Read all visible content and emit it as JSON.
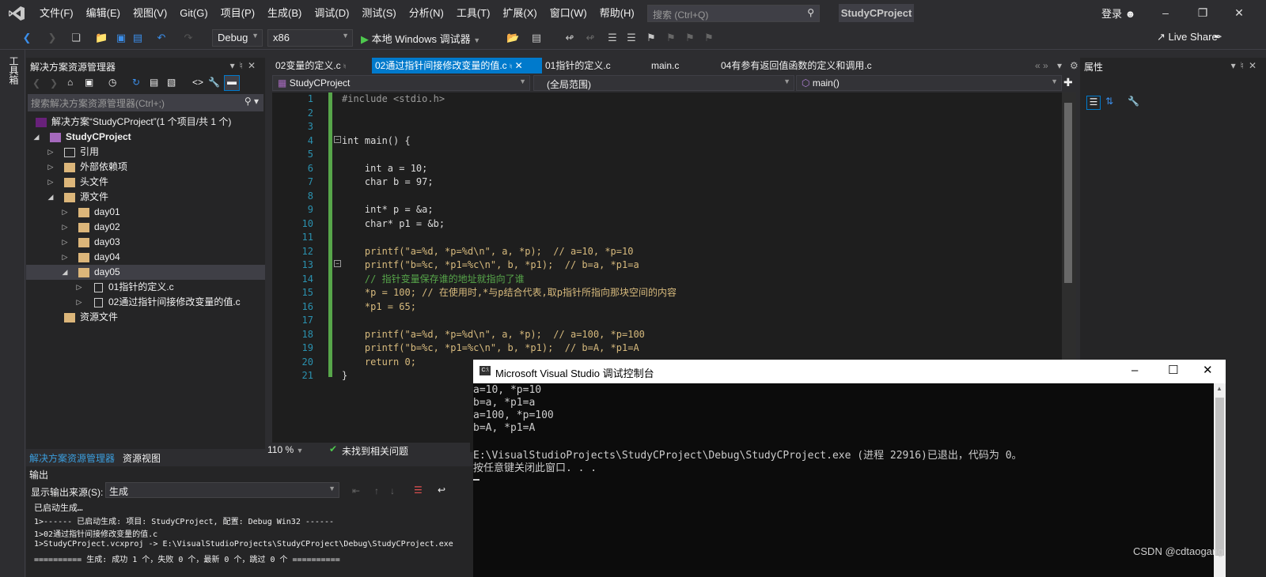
{
  "menu": [
    "文件(F)",
    "编辑(E)",
    "视图(V)",
    "Git(G)",
    "项目(P)",
    "生成(B)",
    "调试(D)",
    "测试(S)",
    "分析(N)",
    "工具(T)",
    "扩展(X)",
    "窗口(W)",
    "帮助(H)"
  ],
  "search": {
    "placeholder": "搜索 (Ctrl+Q)"
  },
  "project_badge": "StudyCProject",
  "login": "登录",
  "toolbar": {
    "config": "Debug",
    "platform": "x86",
    "run_label": "本地 Windows 调试器",
    "live_share": "Live Share"
  },
  "left_tool_strip": "工具箱",
  "solution_explorer": {
    "title": "解决方案资源管理器",
    "search_placeholder": "搜索解决方案资源管理器(Ctrl+;)",
    "nodes": [
      {
        "label": "解决方案“StudyCProject”(1 个项目/共 1 个)"
      },
      {
        "label": "StudyCProject"
      },
      {
        "label": "引用"
      },
      {
        "label": "外部依赖项"
      },
      {
        "label": "头文件"
      },
      {
        "label": "源文件"
      },
      {
        "label": "day01"
      },
      {
        "label": "day02"
      },
      {
        "label": "day03"
      },
      {
        "label": "day04"
      },
      {
        "label": "day05"
      },
      {
        "label": "01指针的定义.c"
      },
      {
        "label": "02通过指针间接修改变量的值.c"
      },
      {
        "label": "资源文件"
      }
    ],
    "bottom_tabs": [
      "解决方案资源管理器",
      "资源视图"
    ]
  },
  "editor": {
    "tabs": [
      "02变量的定义.c",
      "02通过指针间接修改变量的值.c",
      "01指针的定义.c",
      "main.c",
      "04有参有返回值函数的定义和调用.c"
    ],
    "nav": {
      "project": "StudyCProject",
      "scope": "(全局范围)",
      "member": "main()"
    },
    "zoom": "110 %",
    "status": "未找到相关问题",
    "line_numbers": [
      "1",
      "2",
      "3",
      "4",
      "5",
      "6",
      "7",
      "8",
      "9",
      "10",
      "11",
      "12",
      "13",
      "14",
      "15",
      "16",
      "17",
      "18",
      "19",
      "20",
      "21"
    ],
    "code_lines": [
      "#include <stdio.h>",
      "",
      "",
      "int main() {",
      "",
      "    int a = 10;",
      "    char b = 97;",
      "",
      "    int* p = &a;",
      "    char* p1 = &b;",
      "",
      "    printf(\"a=%d, *p=%d\\n\", a, *p);  // a=10, *p=10",
      "    printf(\"b=%c, *p1=%c\\n\", b, *p1);  // b=a, *p1=a",
      "    // 指针变量保存谁的地址就指向了谁",
      "    *p = 100; // 在使用时,*与p结合代表,取p指针所指向那块空间的内容",
      "    *p1 = 65;",
      "",
      "    printf(\"a=%d, *p=%d\\n\", a, *p);  // a=100, *p=100",
      "    printf(\"b=%c, *p1=%c\\n\", b, *p1);  // b=A, *p1=A",
      "    return 0;",
      "}"
    ]
  },
  "properties": {
    "title": "属性"
  },
  "output": {
    "title": "输出",
    "source_label": "显示输出来源(S):",
    "source_value": "生成",
    "lines": [
      "已启动生成…",
      "1>------ 已启动生成: 项目: StudyCProject, 配置: Debug Win32 ------",
      "1>02通过指针间接修改变量的值.c",
      "1>StudyCProject.vcxproj -> E:\\VisualStudioProjects\\StudyCProject\\Debug\\StudyCProject.exe",
      "========== 生成: 成功 1 个，失败 0 个，最新 0 个，跳过 0 个 =========="
    ]
  },
  "console": {
    "title": "Microsoft Visual Studio 调试控制台",
    "lines": [
      "a=10, *p=10",
      "b=a, *p1=a",
      "a=100, *p=100",
      "b=A, *p1=A",
      "",
      "E:\\VisualStudioProjects\\StudyCProject\\Debug\\StudyCProject.exe (进程 22916)已退出，代码为 0。",
      "按任意键关闭此窗口. . ."
    ]
  },
  "watermark": "CSDN @cdtaogang"
}
